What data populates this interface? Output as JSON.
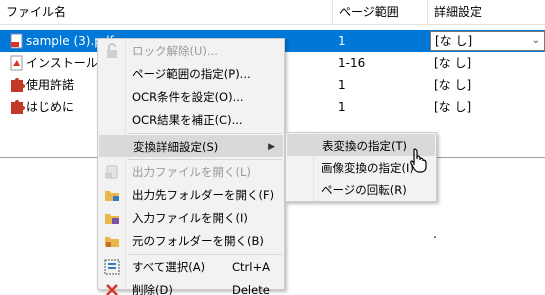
{
  "columns": {
    "name": "ファイル名",
    "page_range": "ページ範囲",
    "detail": "詳細設定"
  },
  "files": [
    {
      "name": "sample (3).pdf",
      "range": "1",
      "detail": "[な し]",
      "icon": "pdf-file-icon",
      "selected": true
    },
    {
      "name": "インストール",
      "range": "1-16",
      "detail": "[な し]",
      "icon": "pdf-file-icon",
      "selected": false
    },
    {
      "name": "使用許諾",
      "range": "1",
      "detail": "[な し]",
      "icon": "puzzle-file-icon",
      "selected": false
    },
    {
      "name": "はじめに",
      "range": "1",
      "detail": "[な し]",
      "icon": "puzzle-file-icon",
      "selected": false
    }
  ],
  "status_dot": ".",
  "context_menu": {
    "items": [
      {
        "label": "ロック解除(U)...",
        "disabled": true,
        "icon": "unlock-icon"
      },
      {
        "label": "ページ範囲の指定(P)...",
        "disabled": false
      },
      {
        "label": "OCR条件を設定(O)...",
        "disabled": false
      },
      {
        "label": "OCR結果を補正(C)...",
        "disabled": false
      },
      {
        "label": "変換詳細設定(S)",
        "disabled": false,
        "submenu": true
      },
      {
        "label": "出力ファイルを開く(L)",
        "disabled": true,
        "icon": "open-output-file-icon"
      },
      {
        "label": "出力先フォルダーを開く(F)",
        "disabled": false,
        "icon": "output-folder-icon"
      },
      {
        "label": "入力ファイルを開く(I)",
        "disabled": false,
        "icon": "input-file-icon"
      },
      {
        "label": "元のフォルダーを開く(B)",
        "disabled": false,
        "icon": "source-folder-icon"
      },
      {
        "label": "すべて選択(A)",
        "shortcut": "Ctrl+A",
        "icon": "select-all-icon"
      },
      {
        "label": "削除(D)",
        "shortcut": "Delete",
        "icon": "delete-x-icon"
      }
    ]
  },
  "submenu": {
    "items": [
      {
        "label": "表変換の指定(T)"
      },
      {
        "label": "画像変換の指定(I)"
      },
      {
        "label": "ページの回転(R)"
      }
    ]
  },
  "colors": {
    "selection": "#0078d7",
    "menu_bg": "#f2f2f2",
    "hover": "#d9d9d9",
    "pdf_red": "#d9342b",
    "puzzle_red": "#c0392b"
  }
}
